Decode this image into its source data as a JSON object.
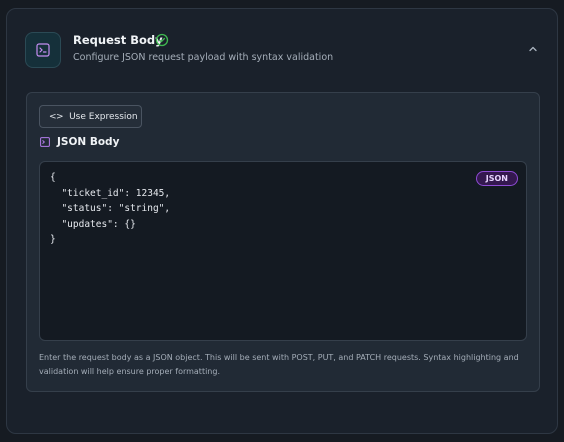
{
  "section": {
    "title": "Request Body",
    "subtitle": "Configure JSON request payload with syntax validation",
    "status_icon": "check-circle-icon",
    "collapse_icon": "chevron-up-icon"
  },
  "toolbar": {
    "expression_label": "Use Expression",
    "expression_icon": "code-brackets-icon"
  },
  "editor": {
    "label": "JSON Body",
    "badge": "JSON",
    "content": "{\n  \"ticket_id\": 12345,\n  \"status\": \"string\",\n  \"updates\": {}\n}"
  },
  "help_text": "Enter the request body as a JSON object. This will be sent with POST, PUT, and PATCH requests. Syntax highlighting and validation will help ensure proper formatting.",
  "colors": {
    "accent_green": "#3fb950",
    "accent_purple": "#a26be0",
    "background": "#161b22"
  }
}
